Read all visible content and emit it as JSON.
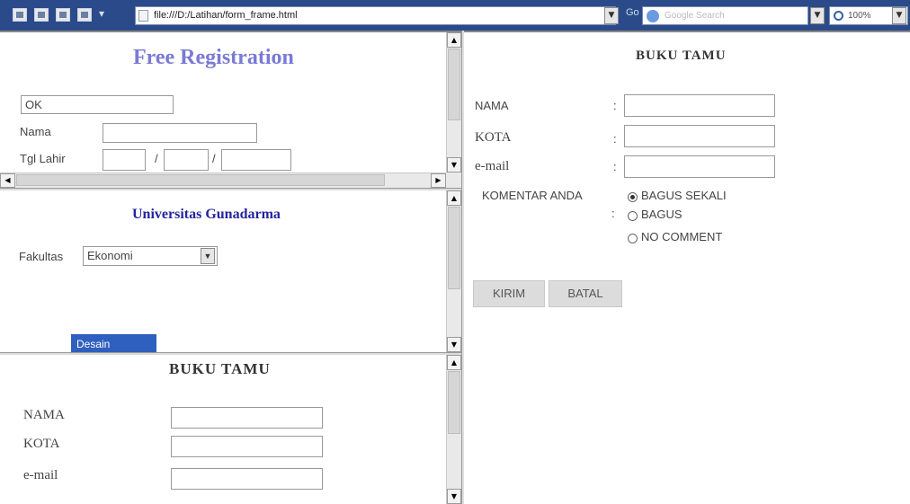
{
  "browser": {
    "address": "file:///D:/Latihan/form_frame.html",
    "search_placeholder": "Google Search",
    "zoom": "100%",
    "go_label": "Go"
  },
  "frame1": {
    "title": "Free Registration",
    "input_value": "OK",
    "nama_label": "Nama",
    "tgl_label": "Tgl Lahir",
    "date_sep": "/"
  },
  "frame2": {
    "title": "Universitas Gunadarma",
    "fakultas_label": "Fakultas",
    "fakultas_value": "Ekonomi",
    "list_item": "Desain"
  },
  "frame3": {
    "title": "BUKU TAMU",
    "labels": [
      "NAMA",
      "KOTA",
      "e-mail"
    ]
  },
  "right": {
    "title": "BUKU TAMU",
    "nama_label": "NAMA",
    "kota_label": "KOTA",
    "email_label": "e-mail",
    "colon": ":",
    "komentar_label": "KOMENTAR ANDA",
    "options": [
      "BAGUS SEKALI",
      "BAGUS",
      "NO COMMENT"
    ],
    "kirim_label": "KIRIM",
    "batal_label": "BATAL"
  }
}
